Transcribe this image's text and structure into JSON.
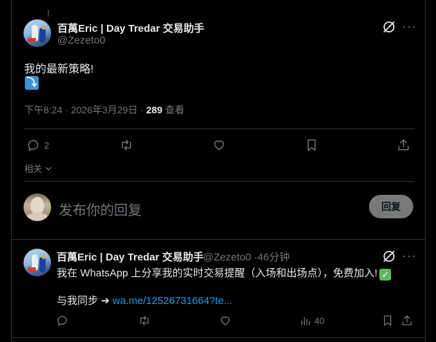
{
  "main_post": {
    "author_name": "百萬Eric | Day Tredar 交易助手",
    "handle": "@Zezeto0",
    "text": "我的最新策略!",
    "emoji": "⤵",
    "timestamp": "下午8:24 · 2026年3月29日 ·",
    "views_count": "289",
    "views_label": "查看",
    "reply_count": "2",
    "related_label": "相关"
  },
  "reply_composer": {
    "placeholder": "发布你的回复",
    "button_label": "回复"
  },
  "reply_post": {
    "author_name": "百萬Eric | Day Tredar 交易助手",
    "handle": "@Zezeto0",
    "separator": "·",
    "time": "46分钟",
    "line1": "我在 WhatsApp 上分享我的实时交易提醒（入场和出场点），免费加入!",
    "check_emoji": "✓",
    "line2_prefix": "与我同步 ➔",
    "link_text": "wa.me/12526731664?te...",
    "views_count": "40"
  },
  "icons": {
    "grok": "grok-slash-circle-icon",
    "more": "more-dots-icon",
    "reply": "speech-bubble-icon",
    "retweet": "retweet-icon",
    "like": "heart-icon",
    "bookmark": "bookmark-icon",
    "share": "share-upload-icon",
    "views": "bar-chart-icon",
    "chevron": "chevron-down-icon"
  },
  "colors": {
    "background": "#000000",
    "text_primary": "#e7e9ea",
    "text_secondary": "#71767b",
    "border": "#2f3336",
    "link": "#1d9bf0",
    "reply_button_bg": "#787a7a"
  }
}
